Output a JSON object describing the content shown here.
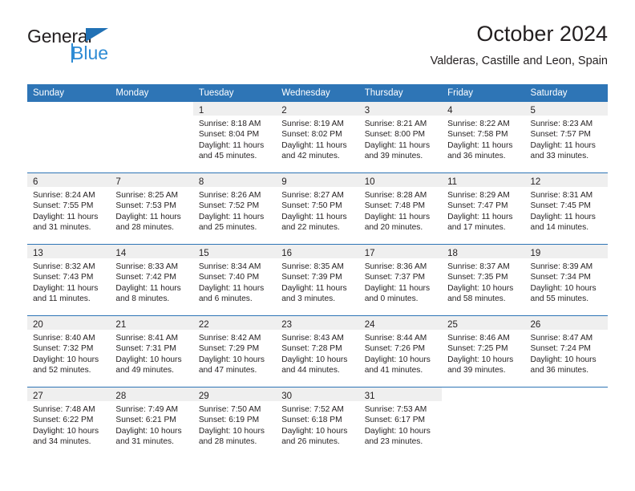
{
  "brand": {
    "name_part1": "General",
    "name_part2": "Blue",
    "triangle_icon": "blue-triangle-icon",
    "accent_color": "#2e8bd4",
    "dark_color": "#231f20"
  },
  "header": {
    "title": "October 2024",
    "location": "Valderas, Castille and Leon, Spain"
  },
  "calendar": {
    "header_bg": "#2e75b6",
    "daynum_bg": "#efefef",
    "weekday_headers": [
      "Sunday",
      "Monday",
      "Tuesday",
      "Wednesday",
      "Thursday",
      "Friday",
      "Saturday"
    ],
    "weeks": [
      [
        {
          "day": "",
          "lines": []
        },
        {
          "day": "",
          "lines": []
        },
        {
          "day": "1",
          "lines": [
            "Sunrise: 8:18 AM",
            "Sunset: 8:04 PM",
            "Daylight: 11 hours",
            "and 45 minutes."
          ]
        },
        {
          "day": "2",
          "lines": [
            "Sunrise: 8:19 AM",
            "Sunset: 8:02 PM",
            "Daylight: 11 hours",
            "and 42 minutes."
          ]
        },
        {
          "day": "3",
          "lines": [
            "Sunrise: 8:21 AM",
            "Sunset: 8:00 PM",
            "Daylight: 11 hours",
            "and 39 minutes."
          ]
        },
        {
          "day": "4",
          "lines": [
            "Sunrise: 8:22 AM",
            "Sunset: 7:58 PM",
            "Daylight: 11 hours",
            "and 36 minutes."
          ]
        },
        {
          "day": "5",
          "lines": [
            "Sunrise: 8:23 AM",
            "Sunset: 7:57 PM",
            "Daylight: 11 hours",
            "and 33 minutes."
          ]
        }
      ],
      [
        {
          "day": "6",
          "lines": [
            "Sunrise: 8:24 AM",
            "Sunset: 7:55 PM",
            "Daylight: 11 hours",
            "and 31 minutes."
          ]
        },
        {
          "day": "7",
          "lines": [
            "Sunrise: 8:25 AM",
            "Sunset: 7:53 PM",
            "Daylight: 11 hours",
            "and 28 minutes."
          ]
        },
        {
          "day": "8",
          "lines": [
            "Sunrise: 8:26 AM",
            "Sunset: 7:52 PM",
            "Daylight: 11 hours",
            "and 25 minutes."
          ]
        },
        {
          "day": "9",
          "lines": [
            "Sunrise: 8:27 AM",
            "Sunset: 7:50 PM",
            "Daylight: 11 hours",
            "and 22 minutes."
          ]
        },
        {
          "day": "10",
          "lines": [
            "Sunrise: 8:28 AM",
            "Sunset: 7:48 PM",
            "Daylight: 11 hours",
            "and 20 minutes."
          ]
        },
        {
          "day": "11",
          "lines": [
            "Sunrise: 8:29 AM",
            "Sunset: 7:47 PM",
            "Daylight: 11 hours",
            "and 17 minutes."
          ]
        },
        {
          "day": "12",
          "lines": [
            "Sunrise: 8:31 AM",
            "Sunset: 7:45 PM",
            "Daylight: 11 hours",
            "and 14 minutes."
          ]
        }
      ],
      [
        {
          "day": "13",
          "lines": [
            "Sunrise: 8:32 AM",
            "Sunset: 7:43 PM",
            "Daylight: 11 hours",
            "and 11 minutes."
          ]
        },
        {
          "day": "14",
          "lines": [
            "Sunrise: 8:33 AM",
            "Sunset: 7:42 PM",
            "Daylight: 11 hours",
            "and 8 minutes."
          ]
        },
        {
          "day": "15",
          "lines": [
            "Sunrise: 8:34 AM",
            "Sunset: 7:40 PM",
            "Daylight: 11 hours",
            "and 6 minutes."
          ]
        },
        {
          "day": "16",
          "lines": [
            "Sunrise: 8:35 AM",
            "Sunset: 7:39 PM",
            "Daylight: 11 hours",
            "and 3 minutes."
          ]
        },
        {
          "day": "17",
          "lines": [
            "Sunrise: 8:36 AM",
            "Sunset: 7:37 PM",
            "Daylight: 11 hours",
            "and 0 minutes."
          ]
        },
        {
          "day": "18",
          "lines": [
            "Sunrise: 8:37 AM",
            "Sunset: 7:35 PM",
            "Daylight: 10 hours",
            "and 58 minutes."
          ]
        },
        {
          "day": "19",
          "lines": [
            "Sunrise: 8:39 AM",
            "Sunset: 7:34 PM",
            "Daylight: 10 hours",
            "and 55 minutes."
          ]
        }
      ],
      [
        {
          "day": "20",
          "lines": [
            "Sunrise: 8:40 AM",
            "Sunset: 7:32 PM",
            "Daylight: 10 hours",
            "and 52 minutes."
          ]
        },
        {
          "day": "21",
          "lines": [
            "Sunrise: 8:41 AM",
            "Sunset: 7:31 PM",
            "Daylight: 10 hours",
            "and 49 minutes."
          ]
        },
        {
          "day": "22",
          "lines": [
            "Sunrise: 8:42 AM",
            "Sunset: 7:29 PM",
            "Daylight: 10 hours",
            "and 47 minutes."
          ]
        },
        {
          "day": "23",
          "lines": [
            "Sunrise: 8:43 AM",
            "Sunset: 7:28 PM",
            "Daylight: 10 hours",
            "and 44 minutes."
          ]
        },
        {
          "day": "24",
          "lines": [
            "Sunrise: 8:44 AM",
            "Sunset: 7:26 PM",
            "Daylight: 10 hours",
            "and 41 minutes."
          ]
        },
        {
          "day": "25",
          "lines": [
            "Sunrise: 8:46 AM",
            "Sunset: 7:25 PM",
            "Daylight: 10 hours",
            "and 39 minutes."
          ]
        },
        {
          "day": "26",
          "lines": [
            "Sunrise: 8:47 AM",
            "Sunset: 7:24 PM",
            "Daylight: 10 hours",
            "and 36 minutes."
          ]
        }
      ],
      [
        {
          "day": "27",
          "lines": [
            "Sunrise: 7:48 AM",
            "Sunset: 6:22 PM",
            "Daylight: 10 hours",
            "and 34 minutes."
          ]
        },
        {
          "day": "28",
          "lines": [
            "Sunrise: 7:49 AM",
            "Sunset: 6:21 PM",
            "Daylight: 10 hours",
            "and 31 minutes."
          ]
        },
        {
          "day": "29",
          "lines": [
            "Sunrise: 7:50 AM",
            "Sunset: 6:19 PM",
            "Daylight: 10 hours",
            "and 28 minutes."
          ]
        },
        {
          "day": "30",
          "lines": [
            "Sunrise: 7:52 AM",
            "Sunset: 6:18 PM",
            "Daylight: 10 hours",
            "and 26 minutes."
          ]
        },
        {
          "day": "31",
          "lines": [
            "Sunrise: 7:53 AM",
            "Sunset: 6:17 PM",
            "Daylight: 10 hours",
            "and 23 minutes."
          ]
        },
        {
          "day": "",
          "lines": []
        },
        {
          "day": "",
          "lines": []
        }
      ]
    ]
  }
}
